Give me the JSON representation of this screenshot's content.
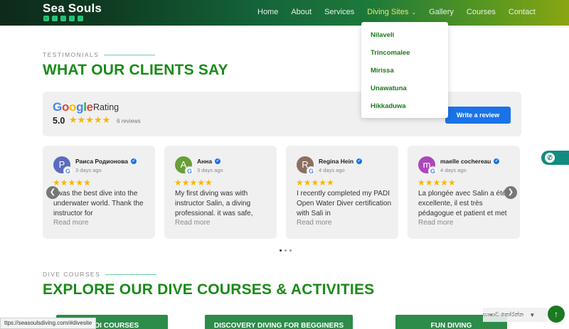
{
  "header": {
    "brand": "Sea Souls",
    "socials": [
      "youtube-icon",
      "facebook-icon",
      "instagram-icon",
      "whatsapp-icon",
      "tiktok-icon"
    ],
    "nav": [
      {
        "label": "Home"
      },
      {
        "label": "About"
      },
      {
        "label": "Services"
      },
      {
        "label": "Diving Sites",
        "active": true
      },
      {
        "label": "Gallery"
      },
      {
        "label": "Courses"
      },
      {
        "label": "Contact"
      }
    ]
  },
  "dropdown": {
    "items": [
      "Nilaveli",
      "Trincomalee",
      "Mirissa",
      "Unawatuna",
      "Hikkaduwa"
    ]
  },
  "testimonials": {
    "eyebrow": "TESTIMONIALS",
    "title": "WHAT OUR CLIENTS SAY",
    "google": {
      "logo": "Google",
      "rating_word": "Rating",
      "score": "5.0",
      "stars": "★★★★★",
      "count": "6 reviews",
      "write_label": "Write a review"
    },
    "reviews": [
      {
        "initial": "P",
        "color": "#5c6bc0",
        "name": "Раиса Родионова",
        "date": "3 days ago",
        "stars": "★★★★★",
        "text": "I was the best dive into the underwater world. Thank the instructor for",
        "more": "Read more"
      },
      {
        "initial": "A",
        "color": "#689f38",
        "name": "Анна",
        "date": "3 days ago",
        "stars": "★★★★★",
        "text": "My first diving was with instructor Salin, a diving professional. it was safe,",
        "more": "Read more"
      },
      {
        "initial": "R",
        "color": "#8d6e63",
        "name": "Regina Hein",
        "date": "4 days ago",
        "stars": "★★★★★",
        "text": "I recently completed my PADI Open Water Diver certification with Sali in",
        "more": "Read more"
      },
      {
        "initial": "m",
        "color": "#ab47bc",
        "name": "maelle cochereau",
        "date": "4 days ago",
        "stars": "★★★★★",
        "text": "La plongée avec Salin a été excellente, il est très pédagogue et patient et met",
        "more": "Read more"
      }
    ]
  },
  "courses": {
    "eyebrow": "DIVE COURSES",
    "title": "EXPLORE OUR DIVE COURSES & ACTIVITIES",
    "buttons": [
      "PADI COURSES",
      "DISCOVERY DIVING FOR BEGGINERS",
      "FUN DIVING"
    ]
  },
  "browser": {
    "status_url": "ttps://seasoulsdiving.com/#divesite"
  },
  "language": {
    "label": "භාෂාව තෝරන්න"
  },
  "colors": {
    "accent_green": "#1a8a18",
    "google_blue": "#1a73e8",
    "star_gold": "#f9b600"
  }
}
